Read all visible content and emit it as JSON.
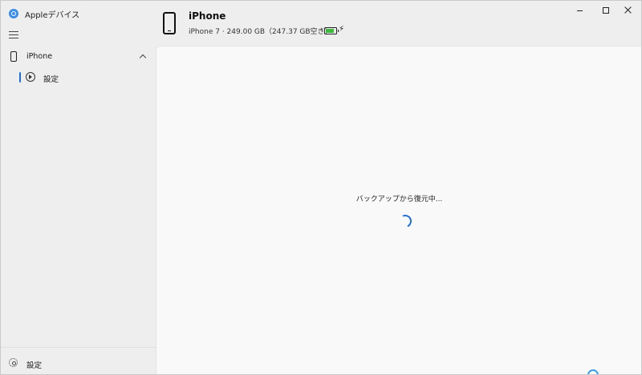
{
  "app": {
    "title": "Appleデバイス"
  },
  "window_controls": {
    "minimize": "minimize",
    "maximize": "maximize",
    "close": "close"
  },
  "sidebar": {
    "device_item": {
      "label": "iPhone"
    },
    "settings_item": {
      "label": "設定"
    },
    "footer_settings": {
      "label": "設定"
    }
  },
  "header": {
    "device_name": "iPhone",
    "device_details": "iPhone 7 · 249.00 GB（247.37 GB空き）",
    "battery_level": 0.8,
    "charging": true,
    "charging_glyph": "⚡"
  },
  "main": {
    "status_text": "バックアップから復元中..."
  },
  "colors": {
    "accent": "#1f6fd1",
    "battery": "#3db93d",
    "background": "#eeeeee",
    "content": "#f9f9f9"
  }
}
